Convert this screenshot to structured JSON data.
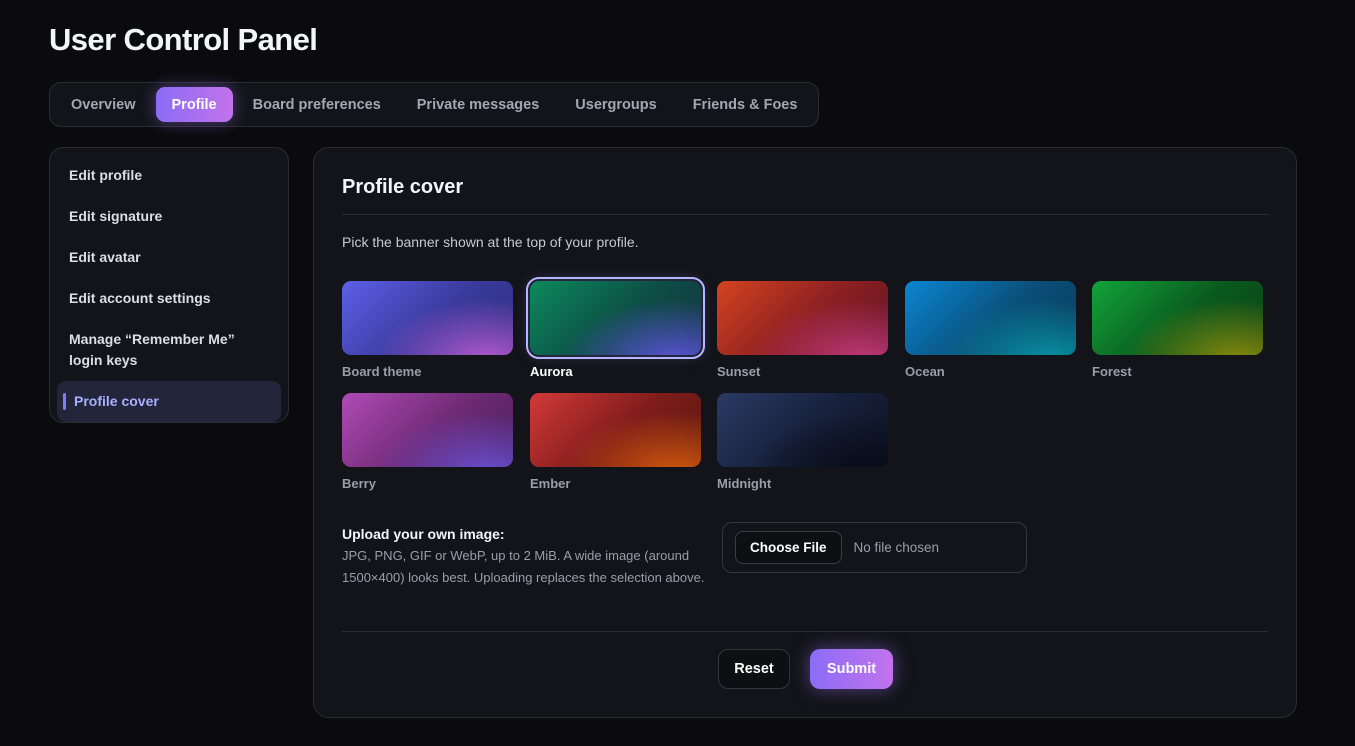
{
  "page": {
    "title": "User Control Panel"
  },
  "tabs": [
    {
      "label": "Overview"
    },
    {
      "label": "Profile"
    },
    {
      "label": "Board preferences"
    },
    {
      "label": "Private messages"
    },
    {
      "label": "Usergroups"
    },
    {
      "label": "Friends & Foes"
    }
  ],
  "active_tab": "Profile",
  "sidebar": {
    "items": [
      {
        "label": "Edit profile"
      },
      {
        "label": "Edit signature"
      },
      {
        "label": "Edit avatar"
      },
      {
        "label": "Edit account settings"
      },
      {
        "label": "Manage “Remember Me”\nlogin keys"
      },
      {
        "label": "Profile cover"
      }
    ],
    "active": "Profile cover"
  },
  "panel": {
    "title": "Profile cover",
    "description": "Pick the banner shown at the top of your profile.",
    "covers": [
      {
        "label": "Board theme",
        "colors": [
          "#5d5fe8",
          "#2f2f7f",
          "#b45ad0"
        ]
      },
      {
        "label": "Aurora",
        "colors": [
          "#0c8a5c",
          "#13333f",
          "#5a55d8"
        ],
        "selected": true
      },
      {
        "label": "Sunset",
        "colors": [
          "#d4431f",
          "#5e1426",
          "#c33a7c"
        ]
      },
      {
        "label": "Ocean",
        "colors": [
          "#0b86d4",
          "#0a3a58",
          "#0894a4"
        ]
      },
      {
        "label": "Forest",
        "colors": [
          "#12a33a",
          "#0c3f17",
          "#8a8c0c"
        ]
      },
      {
        "label": "Berry",
        "colors": [
          "#b04ab6",
          "#4a1f5a",
          "#6a4fd0"
        ]
      },
      {
        "label": "Ember",
        "colors": [
          "#d4393a",
          "#5a1810",
          "#d4590e"
        ]
      },
      {
        "label": "Midnight",
        "colors": [
          "#2a3a64",
          "#0d1424",
          "#080c18"
        ]
      }
    ],
    "upload": {
      "title": "Upload your own image:",
      "help": "JPG, PNG, GIF or WebP, up to 2 MiB. A wide image (around 1500×400) looks best. Uploading replaces the selection above.",
      "choose_label": "Choose File",
      "status": "No file chosen"
    },
    "buttons": {
      "reset": "Reset",
      "submit": "Submit"
    }
  },
  "colors": {
    "background": "#0b0b0e",
    "panel": "#131419",
    "accent_start": "#8b6cf7",
    "accent_end": "#c273ec",
    "active_nav_text": "#a8b0ff"
  }
}
